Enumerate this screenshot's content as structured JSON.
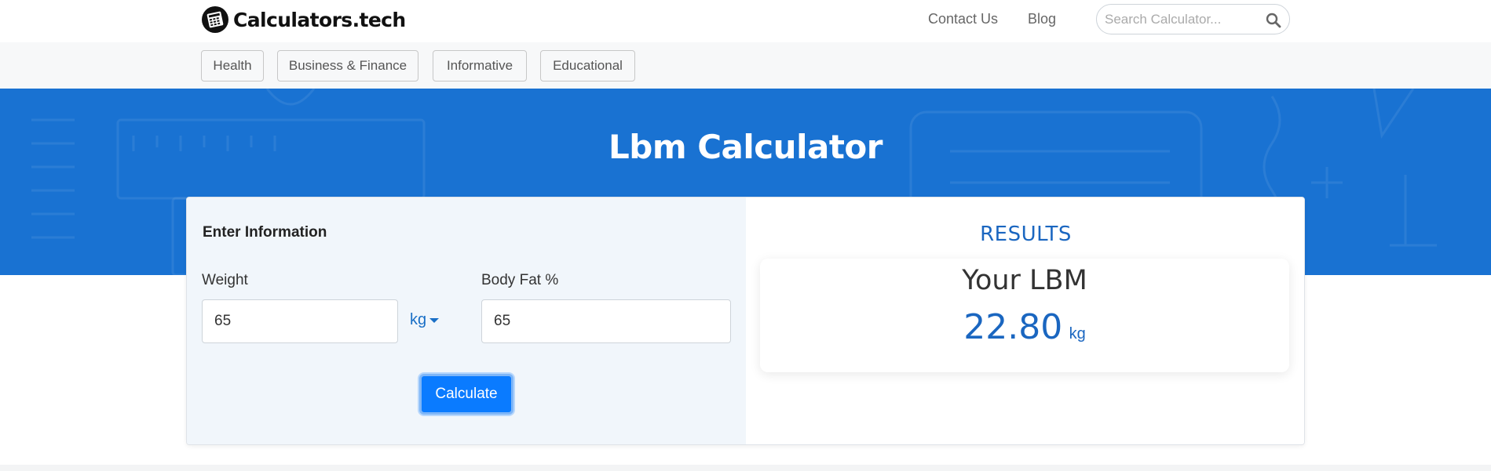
{
  "header": {
    "brand": "Calculators.tech",
    "nav": [
      {
        "label": "Contact Us"
      },
      {
        "label": "Blog"
      }
    ],
    "search": {
      "placeholder": "Search Calculator..."
    }
  },
  "categories": [
    {
      "label": "Health"
    },
    {
      "label": "Business & Finance"
    },
    {
      "label": "Informative"
    },
    {
      "label": "Educational"
    }
  ],
  "hero": {
    "title": "Lbm Calculator"
  },
  "form": {
    "section_title": "Enter Information",
    "weight": {
      "label": "Weight",
      "value": "65",
      "unit": "kg"
    },
    "body_fat": {
      "label": "Body Fat %",
      "value": "65"
    },
    "submit_label": "Calculate"
  },
  "results": {
    "heading": "RESULTS",
    "label": "Your LBM",
    "value": "22.80",
    "unit": "kg"
  },
  "colors": {
    "hero_blue": "#1972d2",
    "accent_blue": "#1a66c0",
    "button_blue": "#0a7bff"
  }
}
